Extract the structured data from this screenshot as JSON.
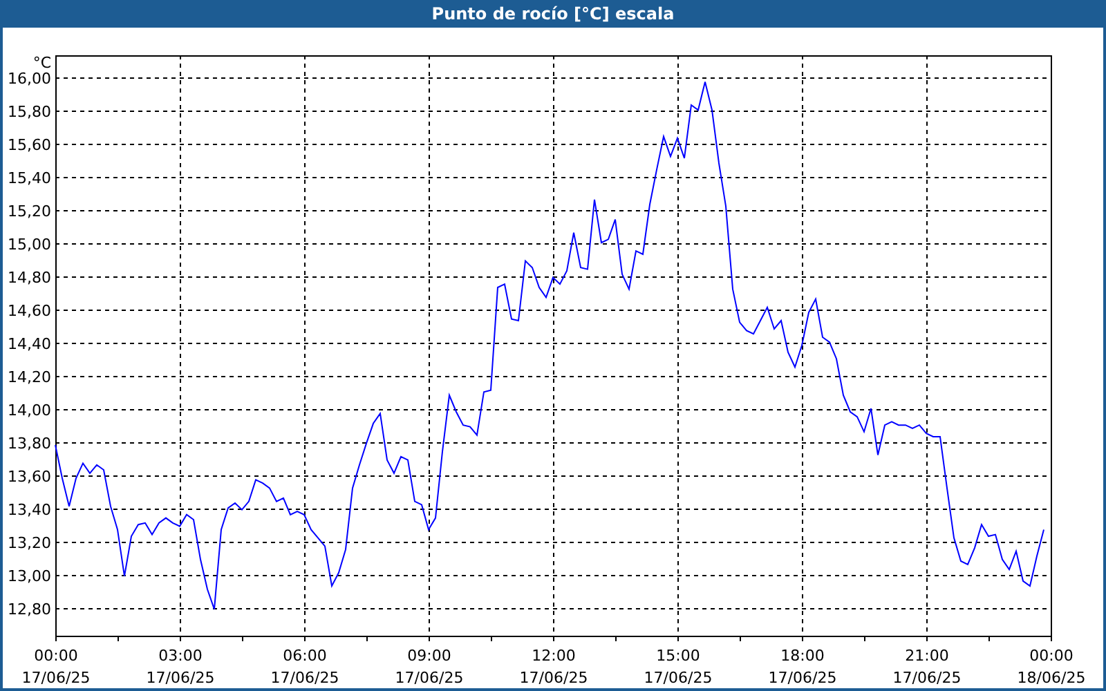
{
  "window": {
    "title": "Punto de rocío [°C] escala"
  },
  "chart": {
    "chart_data": {
      "type": "line",
      "grid": true,
      "ylabel": "°C",
      "ylim": [
        12.63,
        16.13
      ],
      "categories": [
        "00:00\n17/06/25",
        null,
        null,
        null,
        null,
        null,
        null,
        null,
        null,
        null,
        null,
        null,
        null,
        null,
        null,
        null,
        null,
        null,
        "03:00\n17/06/25",
        null,
        null,
        null,
        null,
        null,
        null,
        null,
        null,
        null,
        null,
        null,
        null,
        null,
        null,
        null,
        null,
        null,
        "06:00\n17/06/25",
        null,
        null,
        null,
        null,
        null,
        null,
        null,
        null,
        null,
        null,
        null,
        null,
        null,
        null,
        null,
        null,
        null,
        "09:00\n17/06/25",
        null,
        null,
        null,
        null,
        null,
        null,
        null,
        null,
        null,
        null,
        null,
        null,
        null,
        null,
        null,
        null,
        null,
        "12:00\n17/06/25",
        null,
        null,
        null,
        null,
        null,
        null,
        null,
        null,
        null,
        null,
        null,
        null,
        null,
        null,
        null,
        null,
        null,
        "15:00\n17/06/25",
        null,
        null,
        null,
        null,
        null,
        null,
        null,
        null,
        null,
        null,
        null,
        null,
        null,
        null,
        null,
        null,
        null,
        "18:00\n17/06/25",
        null,
        null,
        null,
        null,
        null,
        null,
        null,
        null,
        null,
        null,
        null,
        null,
        null,
        null,
        null,
        null,
        null,
        "21:00\n17/06/25",
        null,
        null,
        null,
        null,
        null,
        null,
        null,
        null,
        null,
        null,
        null,
        null,
        null,
        null,
        null,
        null,
        null,
        "00:00\n18/06/25"
      ],
      "yticks": [
        {
          "value": 12.8,
          "label": "12,80"
        },
        {
          "value": 13,
          "label": "13,00"
        },
        {
          "value": 13.2,
          "label": "13,20"
        },
        {
          "value": 13.4,
          "label": "13,40"
        },
        {
          "value": 13.6,
          "label": "13,60"
        },
        {
          "value": 13.8,
          "label": "13,80"
        },
        {
          "value": 14,
          "label": "14,00"
        },
        {
          "value": 14.2,
          "label": "14,20"
        },
        {
          "value": 14.4,
          "label": "14,40"
        },
        {
          "value": 14.6,
          "label": "14,60"
        },
        {
          "value": 14.8,
          "label": "14,80"
        },
        {
          "value": 15,
          "label": "15,00"
        },
        {
          "value": 15.2,
          "label": "15,20"
        },
        {
          "value": 15.4,
          "label": "15,40"
        },
        {
          "value": 15.6,
          "label": "15,60"
        },
        {
          "value": 15.8,
          "label": "15,80"
        },
        {
          "value": 16,
          "label": "16,00"
        }
      ],
      "series": [
        {
          "color": "#0000ff",
          "values": [
            13.78,
            13.58,
            13.41,
            13.58,
            13.67,
            13.61,
            13.66,
            13.63,
            13.41,
            13.27,
            12.99,
            13.23,
            13.3,
            13.31,
            13.24,
            13.31,
            13.34,
            13.31,
            13.29,
            13.36,
            13.33,
            13.09,
            12.91,
            12.79,
            13.27,
            13.4,
            13.43,
            13.39,
            13.44,
            13.57,
            13.55,
            13.52,
            13.44,
            13.46,
            13.36,
            13.38,
            13.36,
            13.27,
            13.22,
            13.17,
            12.93,
            13.01,
            13.15,
            13.52,
            13.66,
            13.79,
            13.91,
            13.97,
            13.69,
            13.61,
            13.71,
            13.69,
            13.44,
            13.42,
            13.27,
            13.34,
            13.74,
            14.08,
            13.98,
            13.9,
            13.89,
            13.84,
            14.1,
            14.11,
            14.73,
            14.75,
            14.54,
            14.53,
            14.89,
            14.85,
            14.73,
            14.67,
            14.79,
            14.75,
            14.83,
            15.06,
            14.85,
            14.84,
            15.26,
            15.0,
            15.02,
            15.14,
            14.81,
            14.72,
            14.95,
            14.93,
            15.23,
            15.44,
            15.64,
            15.52,
            15.63,
            15.51,
            15.83,
            15.8,
            15.97,
            15.8,
            15.48,
            15.22,
            14.72,
            14.52,
            14.47,
            14.45,
            14.53,
            14.61,
            14.48,
            14.53,
            14.34,
            14.25,
            14.38,
            14.58,
            14.66,
            14.43,
            14.4,
            14.3,
            14.08,
            13.98,
            13.95,
            13.86,
            14.0,
            13.72,
            13.9,
            13.92,
            13.9,
            13.9,
            13.88,
            13.9,
            13.85,
            13.83,
            13.83,
            13.52,
            13.22,
            13.08,
            13.06,
            13.16,
            13.3,
            13.23,
            13.24,
            13.09,
            13.03,
            13.14,
            12.96,
            12.93,
            13.11,
            13.27,
            null
          ]
        }
      ]
    }
  }
}
